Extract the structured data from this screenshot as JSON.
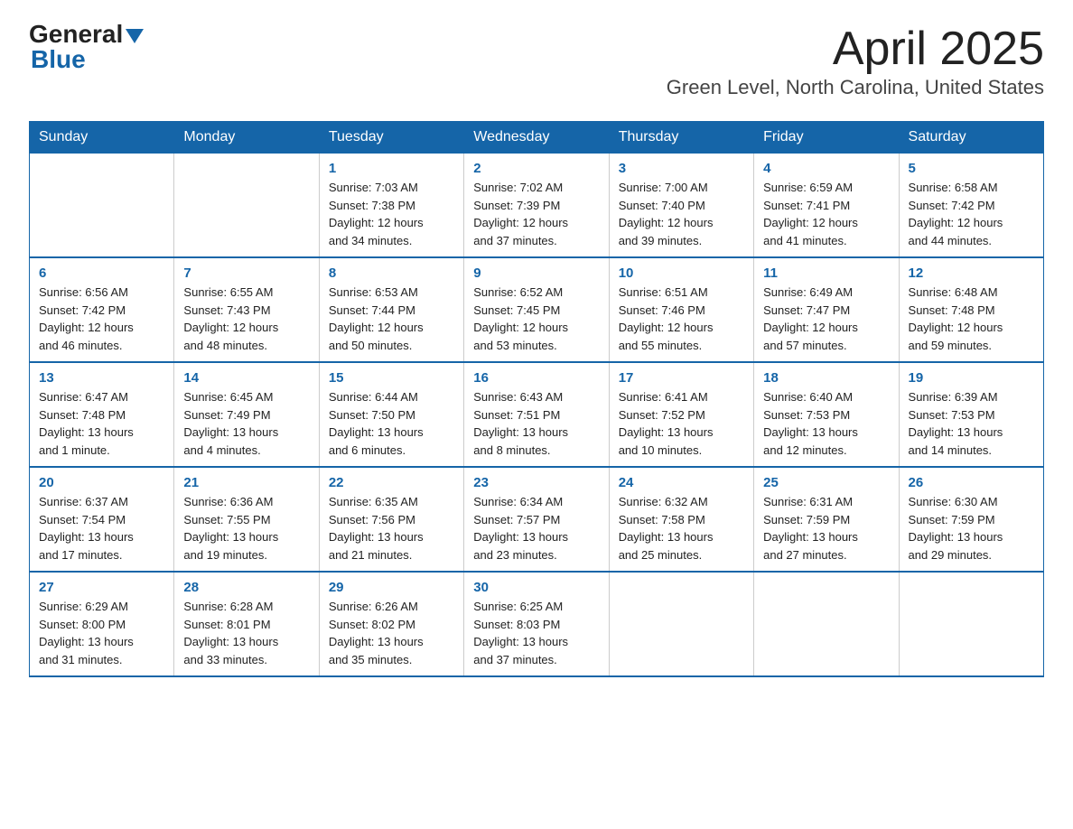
{
  "logo": {
    "general": "General",
    "blue": "Blue"
  },
  "header": {
    "month": "April 2025",
    "location": "Green Level, North Carolina, United States"
  },
  "weekdays": [
    "Sunday",
    "Monday",
    "Tuesday",
    "Wednesday",
    "Thursday",
    "Friday",
    "Saturday"
  ],
  "weeks": [
    [
      {
        "day": "",
        "info": ""
      },
      {
        "day": "",
        "info": ""
      },
      {
        "day": "1",
        "info": "Sunrise: 7:03 AM\nSunset: 7:38 PM\nDaylight: 12 hours\nand 34 minutes."
      },
      {
        "day": "2",
        "info": "Sunrise: 7:02 AM\nSunset: 7:39 PM\nDaylight: 12 hours\nand 37 minutes."
      },
      {
        "day": "3",
        "info": "Sunrise: 7:00 AM\nSunset: 7:40 PM\nDaylight: 12 hours\nand 39 minutes."
      },
      {
        "day": "4",
        "info": "Sunrise: 6:59 AM\nSunset: 7:41 PM\nDaylight: 12 hours\nand 41 minutes."
      },
      {
        "day": "5",
        "info": "Sunrise: 6:58 AM\nSunset: 7:42 PM\nDaylight: 12 hours\nand 44 minutes."
      }
    ],
    [
      {
        "day": "6",
        "info": "Sunrise: 6:56 AM\nSunset: 7:42 PM\nDaylight: 12 hours\nand 46 minutes."
      },
      {
        "day": "7",
        "info": "Sunrise: 6:55 AM\nSunset: 7:43 PM\nDaylight: 12 hours\nand 48 minutes."
      },
      {
        "day": "8",
        "info": "Sunrise: 6:53 AM\nSunset: 7:44 PM\nDaylight: 12 hours\nand 50 minutes."
      },
      {
        "day": "9",
        "info": "Sunrise: 6:52 AM\nSunset: 7:45 PM\nDaylight: 12 hours\nand 53 minutes."
      },
      {
        "day": "10",
        "info": "Sunrise: 6:51 AM\nSunset: 7:46 PM\nDaylight: 12 hours\nand 55 minutes."
      },
      {
        "day": "11",
        "info": "Sunrise: 6:49 AM\nSunset: 7:47 PM\nDaylight: 12 hours\nand 57 minutes."
      },
      {
        "day": "12",
        "info": "Sunrise: 6:48 AM\nSunset: 7:48 PM\nDaylight: 12 hours\nand 59 minutes."
      }
    ],
    [
      {
        "day": "13",
        "info": "Sunrise: 6:47 AM\nSunset: 7:48 PM\nDaylight: 13 hours\nand 1 minute."
      },
      {
        "day": "14",
        "info": "Sunrise: 6:45 AM\nSunset: 7:49 PM\nDaylight: 13 hours\nand 4 minutes."
      },
      {
        "day": "15",
        "info": "Sunrise: 6:44 AM\nSunset: 7:50 PM\nDaylight: 13 hours\nand 6 minutes."
      },
      {
        "day": "16",
        "info": "Sunrise: 6:43 AM\nSunset: 7:51 PM\nDaylight: 13 hours\nand 8 minutes."
      },
      {
        "day": "17",
        "info": "Sunrise: 6:41 AM\nSunset: 7:52 PM\nDaylight: 13 hours\nand 10 minutes."
      },
      {
        "day": "18",
        "info": "Sunrise: 6:40 AM\nSunset: 7:53 PM\nDaylight: 13 hours\nand 12 minutes."
      },
      {
        "day": "19",
        "info": "Sunrise: 6:39 AM\nSunset: 7:53 PM\nDaylight: 13 hours\nand 14 minutes."
      }
    ],
    [
      {
        "day": "20",
        "info": "Sunrise: 6:37 AM\nSunset: 7:54 PM\nDaylight: 13 hours\nand 17 minutes."
      },
      {
        "day": "21",
        "info": "Sunrise: 6:36 AM\nSunset: 7:55 PM\nDaylight: 13 hours\nand 19 minutes."
      },
      {
        "day": "22",
        "info": "Sunrise: 6:35 AM\nSunset: 7:56 PM\nDaylight: 13 hours\nand 21 minutes."
      },
      {
        "day": "23",
        "info": "Sunrise: 6:34 AM\nSunset: 7:57 PM\nDaylight: 13 hours\nand 23 minutes."
      },
      {
        "day": "24",
        "info": "Sunrise: 6:32 AM\nSunset: 7:58 PM\nDaylight: 13 hours\nand 25 minutes."
      },
      {
        "day": "25",
        "info": "Sunrise: 6:31 AM\nSunset: 7:59 PM\nDaylight: 13 hours\nand 27 minutes."
      },
      {
        "day": "26",
        "info": "Sunrise: 6:30 AM\nSunset: 7:59 PM\nDaylight: 13 hours\nand 29 minutes."
      }
    ],
    [
      {
        "day": "27",
        "info": "Sunrise: 6:29 AM\nSunset: 8:00 PM\nDaylight: 13 hours\nand 31 minutes."
      },
      {
        "day": "28",
        "info": "Sunrise: 6:28 AM\nSunset: 8:01 PM\nDaylight: 13 hours\nand 33 minutes."
      },
      {
        "day": "29",
        "info": "Sunrise: 6:26 AM\nSunset: 8:02 PM\nDaylight: 13 hours\nand 35 minutes."
      },
      {
        "day": "30",
        "info": "Sunrise: 6:25 AM\nSunset: 8:03 PM\nDaylight: 13 hours\nand 37 minutes."
      },
      {
        "day": "",
        "info": ""
      },
      {
        "day": "",
        "info": ""
      },
      {
        "day": "",
        "info": ""
      }
    ]
  ]
}
